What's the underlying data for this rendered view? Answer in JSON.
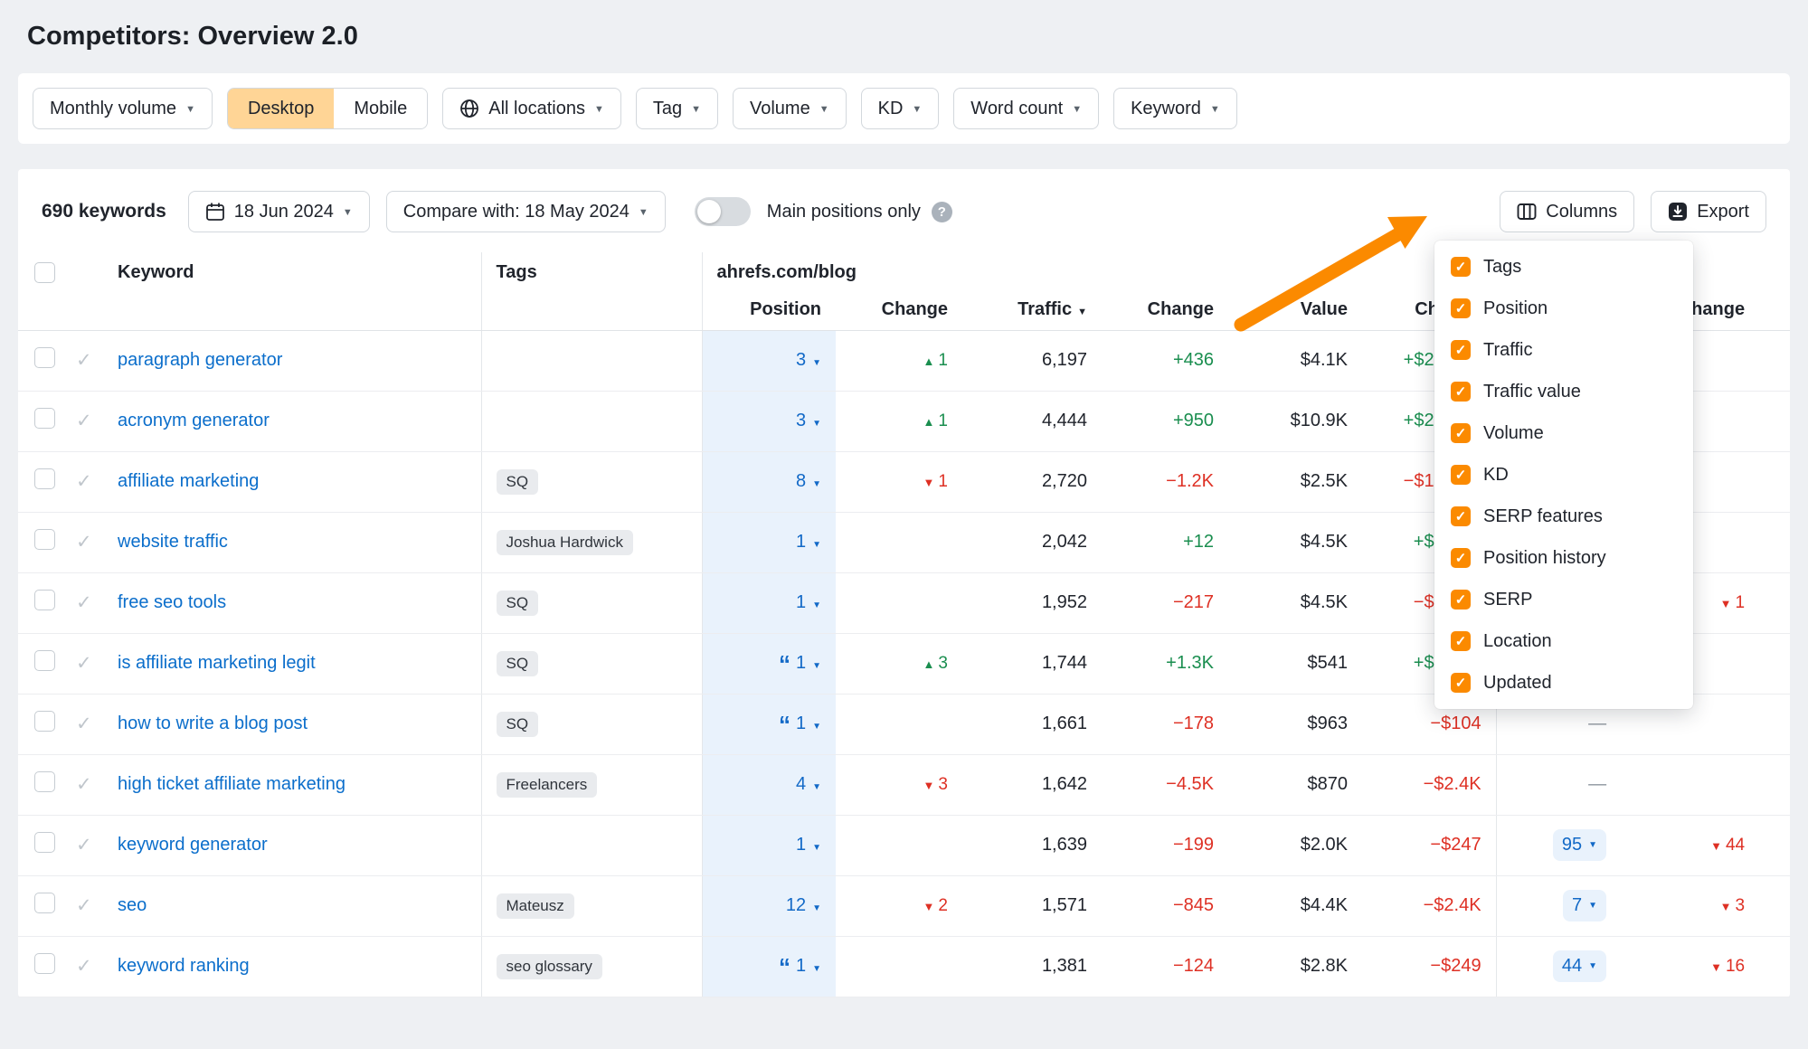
{
  "page": {
    "title": "Competitors: Overview 2.0"
  },
  "glyphs": {
    "caret_down": "▼",
    "check": "✓",
    "quote": "“",
    "dash": "—",
    "triangle_up": "▲",
    "triangle_down": "▼",
    "help": "?"
  },
  "colors": {
    "accent_orange": "#fb8a00",
    "link_blue": "#0b6ecb",
    "positive_green": "#1a8e4f",
    "negative_red": "#de3024",
    "position_bg": "#e9f2fc",
    "selected_segment_bg": "#ffd596"
  },
  "filters": {
    "monthly_volume": "Monthly volume",
    "desktop": "Desktop",
    "mobile": "Mobile",
    "locations": "All locations",
    "tag": "Tag",
    "volume": "Volume",
    "kd": "KD",
    "word_count": "Word count",
    "keyword": "Keyword"
  },
  "toolbar": {
    "keywords_count": "690 keywords",
    "date": "18 Jun 2024",
    "compare": "Compare with: 18 May 2024",
    "main_positions": "Main positions only",
    "columns": "Columns",
    "export": "Export"
  },
  "table": {
    "group_header": "ahrefs.com/blog",
    "headers": {
      "keyword": "Keyword",
      "tags": "Tags",
      "position": "Position",
      "change": "Change",
      "traffic": "Traffic",
      "value": "Value"
    },
    "rows": [
      {
        "keyword": "paragraph generator",
        "tag": "",
        "quote": false,
        "position": "3",
        "pos_change": {
          "dir": "up",
          "val": "1"
        },
        "traffic": "6,197",
        "traffic_change": "+436",
        "value": "$4.1K",
        "value_change": "+$2",
        "value_change_cut": true,
        "pos_history": "",
        "far_change": null
      },
      {
        "keyword": "acronym generator",
        "tag": "",
        "quote": false,
        "position": "3",
        "pos_change": {
          "dir": "up",
          "val": "1"
        },
        "traffic": "4,444",
        "traffic_change": "+950",
        "value": "$10.9K",
        "value_change": "+$2",
        "value_change_cut": true,
        "pos_history": "",
        "far_change": null
      },
      {
        "keyword": "affiliate marketing",
        "tag": "SQ",
        "quote": false,
        "position": "8",
        "pos_change": {
          "dir": "down",
          "val": "1"
        },
        "traffic": "2,720",
        "traffic_change": "−1.2K",
        "value": "$2.5K",
        "value_change": "−$1",
        "value_change_cut": true,
        "pos_history": "",
        "far_change": null
      },
      {
        "keyword": "website traffic",
        "tag": "Joshua Hardwick",
        "quote": false,
        "position": "1",
        "pos_change": null,
        "traffic": "2,042",
        "traffic_change": "+12",
        "value": "$4.5K",
        "value_change": "+$",
        "value_change_cut": true,
        "pos_history": "",
        "far_change": null
      },
      {
        "keyword": "free seo tools",
        "tag": "SQ",
        "quote": false,
        "position": "1",
        "pos_change": null,
        "traffic": "1,952",
        "traffic_change": "−217",
        "value": "$4.5K",
        "value_change": "−$",
        "value_change_cut": true,
        "pos_history": "",
        "far_change": {
          "dir": "down",
          "val": "1"
        }
      },
      {
        "keyword": "is affiliate marketing legit",
        "tag": "SQ",
        "quote": true,
        "position": "1",
        "pos_change": {
          "dir": "up",
          "val": "3"
        },
        "traffic": "1,744",
        "traffic_change": "+1.3K",
        "value": "$541",
        "value_change": "+$",
        "value_change_cut": true,
        "pos_history": "",
        "far_change": null
      },
      {
        "keyword": "how to write a blog post",
        "tag": "SQ",
        "quote": true,
        "position": "1",
        "pos_change": null,
        "traffic": "1,661",
        "traffic_change": "−178",
        "value": "$963",
        "value_change": "−$104",
        "value_change_cut": false,
        "pos_history": "—",
        "far_change": null
      },
      {
        "keyword": "high ticket affiliate marketing",
        "tag": "Freelancers",
        "quote": false,
        "position": "4",
        "pos_change": {
          "dir": "down",
          "val": "3"
        },
        "traffic": "1,642",
        "traffic_change": "−4.5K",
        "value": "$870",
        "value_change": "−$2.4K",
        "value_change_cut": false,
        "pos_history": "—",
        "far_change": null
      },
      {
        "keyword": "keyword generator",
        "tag": "",
        "quote": false,
        "position": "1",
        "pos_change": null,
        "traffic": "1,639",
        "traffic_change": "−199",
        "value": "$2.0K",
        "value_change": "−$247",
        "value_change_cut": false,
        "pos_history": "95",
        "far_change": {
          "dir": "down",
          "val": "44"
        }
      },
      {
        "keyword": "seo",
        "tag": "Mateusz",
        "quote": false,
        "position": "12",
        "pos_change": {
          "dir": "down",
          "val": "2"
        },
        "traffic": "1,571",
        "traffic_change": "−845",
        "value": "$4.4K",
        "value_change": "−$2.4K",
        "value_change_cut": false,
        "pos_history": "7",
        "far_change": {
          "dir": "down",
          "val": "3"
        }
      },
      {
        "keyword": "keyword ranking",
        "tag": "seo glossary",
        "quote": true,
        "position": "1",
        "pos_change": null,
        "traffic": "1,381",
        "traffic_change": "−124",
        "value": "$2.8K",
        "value_change": "−$249",
        "value_change_cut": false,
        "pos_history": "44",
        "far_change": {
          "dir": "down",
          "val": "16"
        }
      }
    ]
  },
  "columns_menu": {
    "checked": true,
    "items": [
      "Tags",
      "Position",
      "Traffic",
      "Traffic value",
      "Volume",
      "KD",
      "SERP features",
      "Position history",
      "SERP",
      "Location",
      "Updated"
    ]
  }
}
